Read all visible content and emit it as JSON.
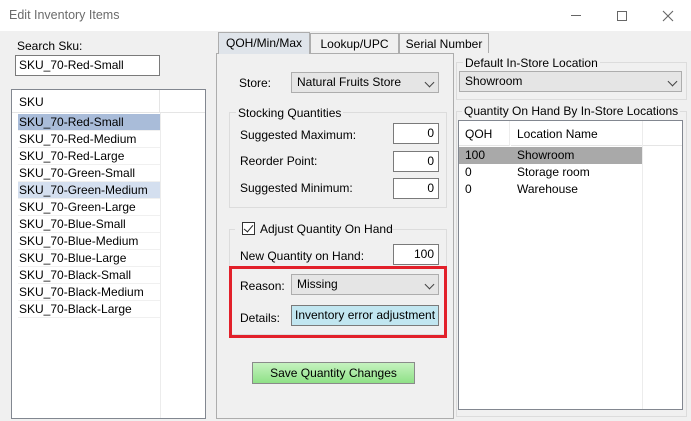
{
  "window": {
    "title": "Edit Inventory Items"
  },
  "search": {
    "label": "Search Sku:",
    "value": "SKU_70-Red-Small"
  },
  "sku_list": {
    "header": "SKU",
    "items": [
      "SKU_70-Red-Small",
      "SKU_70-Red-Medium",
      "SKU_70-Red-Large",
      "SKU_70-Green-Small",
      "SKU_70-Green-Medium",
      "SKU_70-Green-Large",
      "SKU_70-Blue-Small",
      "SKU_70-Blue-Medium",
      "SKU_70-Blue-Large",
      "SKU_70-Black-Small",
      "SKU_70-Black-Medium",
      "SKU_70-Black-Large"
    ],
    "selected_index": 0,
    "secondary_highlight_index": 4
  },
  "tabs": [
    {
      "label": "QOH/Min/Max",
      "active": true
    },
    {
      "label": "Lookup/UPC",
      "active": false
    },
    {
      "label": "Serial Number",
      "active": false
    }
  ],
  "qoh": {
    "store_label": "Store:",
    "store_value": "Natural Fruits Store",
    "stocking_group_title": "Stocking Quantities",
    "suggested_max_label": "Suggested Maximum:",
    "suggested_max_value": "0",
    "reorder_point_label": "Reorder Point:",
    "reorder_point_value": "0",
    "suggested_min_label": "Suggested Minimum:",
    "suggested_min_value": "0",
    "adjust_checkbox_label": "Adjust Quantity On Hand",
    "adjust_checked": true,
    "new_qty_label": "New Quantity on Hand:",
    "new_qty_value": "100",
    "reason_label": "Reason:",
    "reason_value": "Missing",
    "details_label": "Details:",
    "details_value": "Inventory error adjustment",
    "save_label": "Save Quantity Changes"
  },
  "default_location": {
    "group_title": "Default In-Store Location",
    "value": "Showroom"
  },
  "qoh_by_location": {
    "group_title": "Quantity On Hand By In-Store Locations",
    "columns": [
      "QOH",
      "Location Name"
    ],
    "rows": [
      {
        "qoh": "100",
        "location": "Showroom"
      },
      {
        "qoh": "0",
        "location": "Storage room"
      },
      {
        "qoh": "0",
        "location": "Warehouse"
      }
    ],
    "selected_index": 0
  },
  "colors": {
    "highlight_border": "#e2202a",
    "save_button": "#a8eaa0",
    "details_field": "#c1e6f0",
    "selected_row": "#a9bcd9"
  }
}
